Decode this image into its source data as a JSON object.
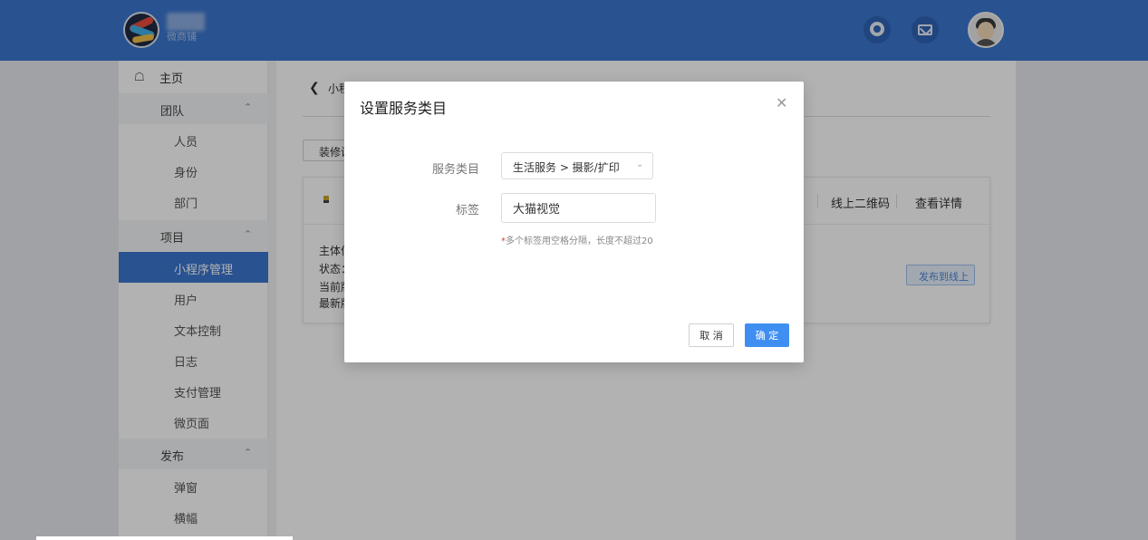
{
  "header": {
    "brand_text": "微商铺",
    "support_icon": "headset-icon",
    "mail_icon": "mail-icon",
    "accent_color": "#3b76cf"
  },
  "sidebar": {
    "home": "主页",
    "groups": [
      {
        "label": "团队",
        "items": [
          "人员",
          "身份",
          "部门"
        ]
      },
      {
        "label": "项目",
        "items": [
          "小程序管理",
          "用户",
          "文本控制",
          "日志",
          "支付管理",
          "微页面"
        ]
      },
      {
        "label": "发布",
        "items": [
          "弹窗",
          "横幅"
        ]
      }
    ],
    "active_item": "小程序管理"
  },
  "main": {
    "back_text": "小程",
    "decor_button": "装修设",
    "card": {
      "qr_link": "线上二维码",
      "detail_link": "查看详情",
      "info_lines": [
        "主体信",
        "状态：",
        "当前版",
        "最新版"
      ],
      "publish_button": "发布到线上"
    }
  },
  "modal": {
    "title": "设置服务类目",
    "category_label": "服务类目",
    "category_value": "生活服务 > 摄影/扩印",
    "tag_label": "标签",
    "tag_value": "大猫视觉",
    "hint_required": "*",
    "hint_text": "多个标签用空格分隔，长度不超过20",
    "cancel_label": "取 消",
    "ok_label": "确 定"
  }
}
